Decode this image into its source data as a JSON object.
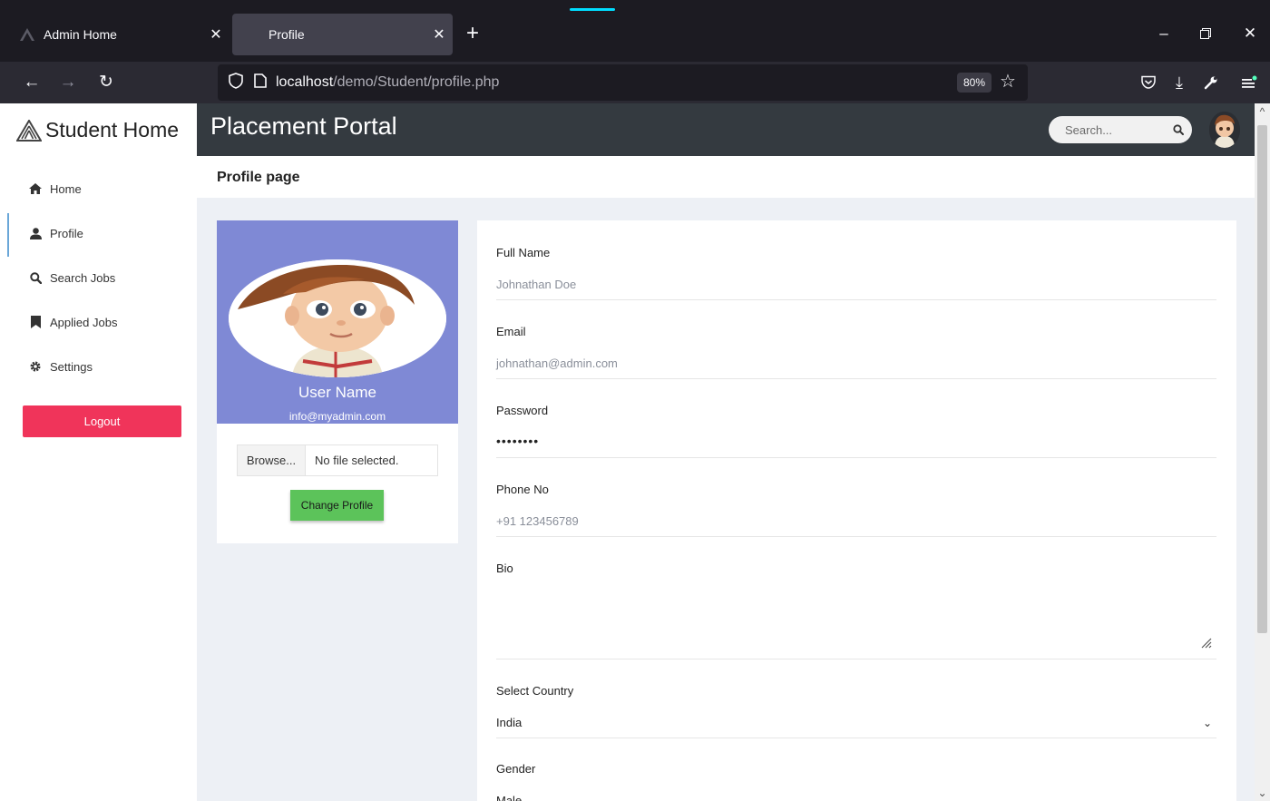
{
  "browser": {
    "tabs": [
      {
        "title": "Admin Home",
        "active": false
      },
      {
        "title": "Profile",
        "active": true
      }
    ],
    "url_host": "localhost",
    "url_path": "/demo/Student/profile.php",
    "zoom": "80%"
  },
  "sidebar": {
    "brand": "Student Home",
    "items": [
      {
        "label": "Home",
        "icon": "home-icon"
      },
      {
        "label": "Profile",
        "icon": "user-icon",
        "active": true
      },
      {
        "label": "Search Jobs",
        "icon": "search-icon"
      },
      {
        "label": "Applied Jobs",
        "icon": "bookmark-icon"
      },
      {
        "label": "Settings",
        "icon": "gear-icon"
      }
    ],
    "logout_label": "Logout"
  },
  "header": {
    "title": "Placement Portal",
    "search_placeholder": "Search..."
  },
  "subheader": {
    "title": "Profile page"
  },
  "profile_card": {
    "user_name": "User Name",
    "user_email": "info@myadmin.com",
    "browse_label": "Browse...",
    "file_status": "No file selected.",
    "change_label": "Change Profile"
  },
  "form": {
    "full_name_label": "Full Name",
    "full_name_value": "Johnathan Doe",
    "email_label": "Email",
    "email_value": "johnathan@admin.com",
    "password_label": "Password",
    "password_value": "••••••••",
    "phone_label": "Phone No",
    "phone_value": "+91 123456789",
    "bio_label": "Bio",
    "bio_value": "",
    "country_label": "Select Country",
    "country_value": "India",
    "gender_label": "Gender",
    "gender_value": "Male"
  },
  "colors": {
    "logout": "#f0345a",
    "change_profile": "#5cc35a",
    "profile_banner": "#7f89d5",
    "header": "#343a40"
  }
}
